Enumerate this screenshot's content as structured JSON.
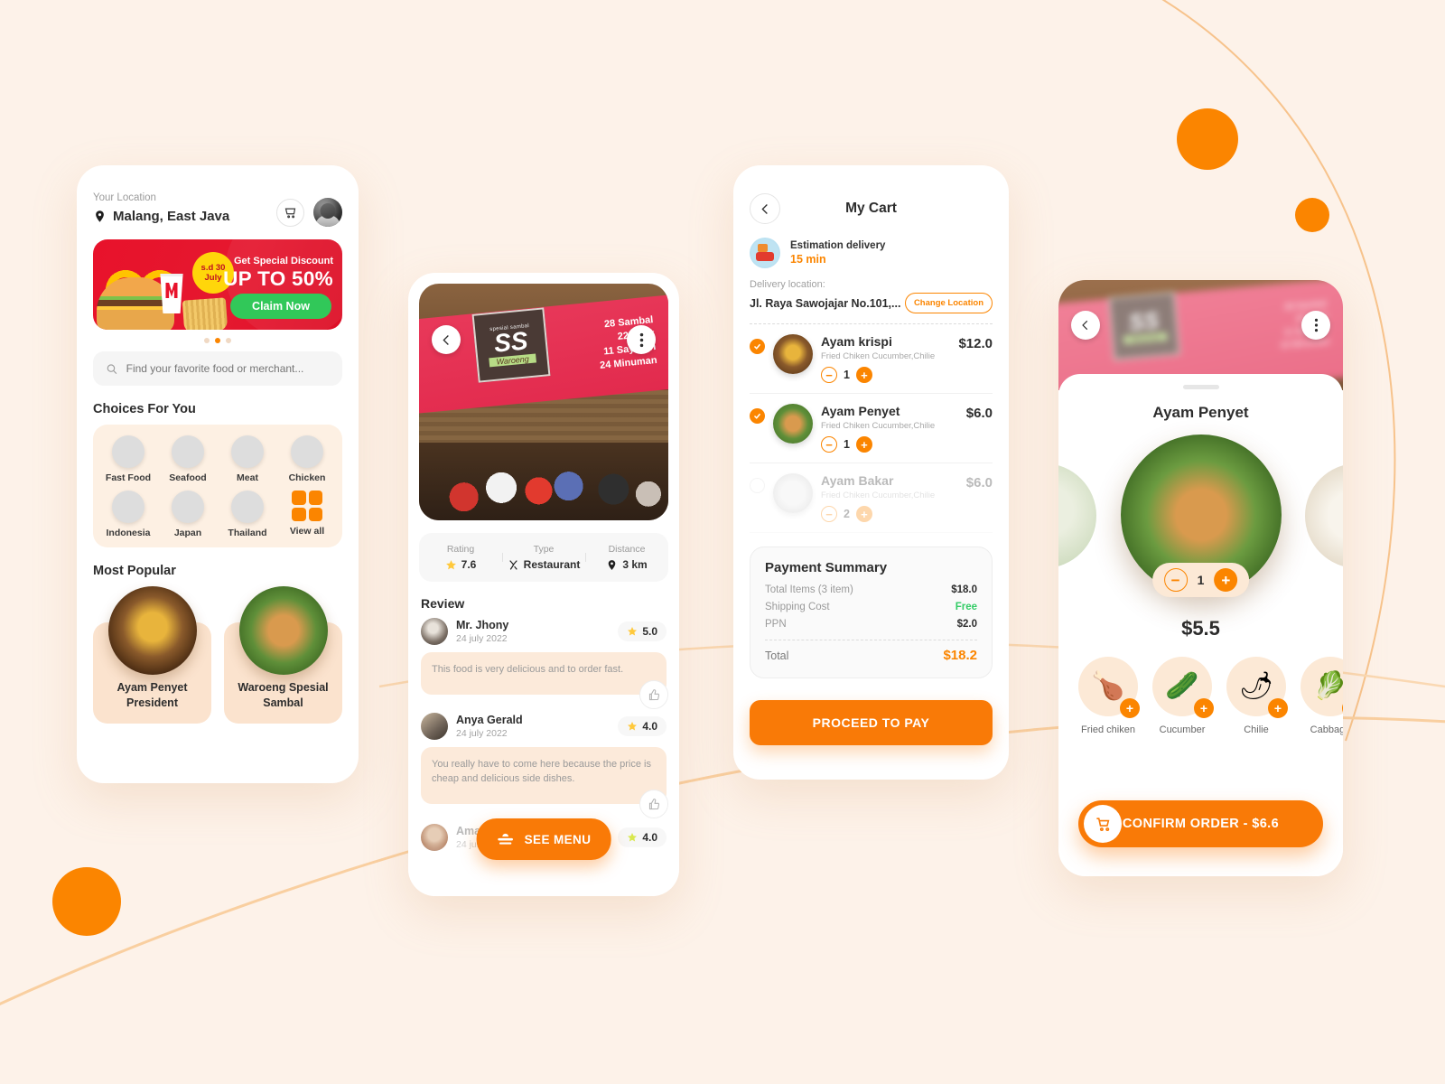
{
  "theme": {
    "bg": "#FDF2E9",
    "accent": "#FB8500",
    "accent_dark": "#F97A07",
    "green": "#31C859",
    "red": "#E8122B"
  },
  "phone1": {
    "location_label": "Your Location",
    "location_value": "Malang, East Java",
    "cart_icon": "cart-icon",
    "avatar_icon": "user-avatar",
    "promo": {
      "badge_line1": "s.d 30",
      "badge_line2": "July",
      "small_text": "Get Special Discount",
      "big_text": "UP TO 50%",
      "cta": "Claim Now",
      "dots": 3,
      "active_dot": 2
    },
    "search_placeholder": "Find your favorite food or merchant...",
    "choices_title": "Choices For You",
    "choices": [
      {
        "label": "Fast Food",
        "icon": "fastfood-thumb"
      },
      {
        "label": "Seafood",
        "icon": "seafood-thumb"
      },
      {
        "label": "Meat",
        "icon": "meat-thumb"
      },
      {
        "label": "Chicken",
        "icon": "chicken-thumb"
      },
      {
        "label": "Indonesia",
        "icon": "indonesia-thumb"
      },
      {
        "label": "Japan",
        "icon": "japan-thumb"
      },
      {
        "label": "Thailand",
        "icon": "thailand-thumb"
      },
      {
        "label": "View all",
        "icon": "grid-icon"
      }
    ],
    "popular_title": "Most Popular",
    "popular": [
      {
        "name": "Ayam Penyet President"
      },
      {
        "name": "Waroeng Spesial Sambal"
      }
    ]
  },
  "phone2": {
    "back_icon": "back-arrow-icon",
    "more_icon": "more-vertical-icon",
    "banner": {
      "logo_top": "spesial sambal",
      "logo_main": "SS",
      "logo_sub": "Waroeng",
      "lines": [
        "28 Sambal",
        "22 Lauk",
        "11 Sayuran",
        "24 Minuman"
      ]
    },
    "meta": [
      {
        "key": "Rating",
        "value": "7.6",
        "icon": "star-icon"
      },
      {
        "key": "Type",
        "value": "Restaurant",
        "icon": "cutlery-icon"
      },
      {
        "key": "Distance",
        "value": "3 km",
        "icon": "pin-icon"
      }
    ],
    "review_title": "Review",
    "reviews": [
      {
        "name": "Mr. Jhony",
        "date": "24 july 2022",
        "rating": "5.0",
        "text": "This food is very delicious and to order fast."
      },
      {
        "name": "Anya Gerald",
        "date": "24 july 2022",
        "rating": "4.0",
        "text": "You really have to come here because the price is cheap and delicious side dishes."
      },
      {
        "name": "Amanda",
        "date": "24 jul 2022",
        "rating": "4.0",
        "text": ""
      }
    ],
    "see_menu": "SEE MENU"
  },
  "phone3": {
    "title": "My Cart",
    "back_icon": "back-arrow-icon",
    "estimation_label": "Estimation delivery",
    "estimation_value": "15 min",
    "delivery_label": "Delivery location:",
    "delivery_address": "Jl. Raya Sawojajar No.101,...",
    "change_location": "Change Location",
    "items": [
      {
        "name": "Ayam krispi",
        "desc": "Fried Chiken Cucumber,Chilie",
        "price": "$12.0",
        "qty": "1",
        "checked": true
      },
      {
        "name": "Ayam Penyet",
        "desc": "Fried Chiken Cucumber,Chilie",
        "price": "$6.0",
        "qty": "1",
        "checked": true
      },
      {
        "name": "Ayam Bakar",
        "desc": "Fried Chiken Cucumber,Chilie",
        "price": "$6.0",
        "qty": "2",
        "checked": false
      }
    ],
    "payment": {
      "title": "Payment Summary",
      "rows": [
        {
          "key": "Total Items (3 item)",
          "value": "$18.0",
          "free": false
        },
        {
          "key": "Shipping Cost",
          "value": "Free",
          "free": true
        },
        {
          "key": "PPN",
          "value": "$2.0",
          "free": false
        }
      ],
      "total_key": "Total",
      "total_value": "$18.2"
    },
    "proceed": "PROCEED TO PAY"
  },
  "phone4": {
    "back_icon": "back-arrow-icon",
    "more_icon": "more-vertical-icon",
    "banner": {
      "logo_main": "SS",
      "logo_sub": "Waroeng",
      "lines": [
        "28 Sambal",
        "22 Lauk",
        "11 Sayuran",
        "24 Minuman"
      ]
    },
    "title": "Ayam Penyet",
    "qty": "1",
    "price": "$5.5",
    "ingredients": [
      {
        "label": "Fried chiken",
        "glyph": "🍗",
        "icon": "fried-chicken-icon"
      },
      {
        "label": "Cucumber",
        "glyph": "🥒",
        "icon": "cucumber-icon"
      },
      {
        "label": "Chilie",
        "glyph": "🌶",
        "icon": "chili-icon"
      },
      {
        "label": "Cabbage",
        "glyph": "🥬",
        "icon": "cabbage-icon"
      }
    ],
    "confirm": "CONFIRM ORDER - $6.6",
    "confirm_icon": "cart-icon"
  }
}
